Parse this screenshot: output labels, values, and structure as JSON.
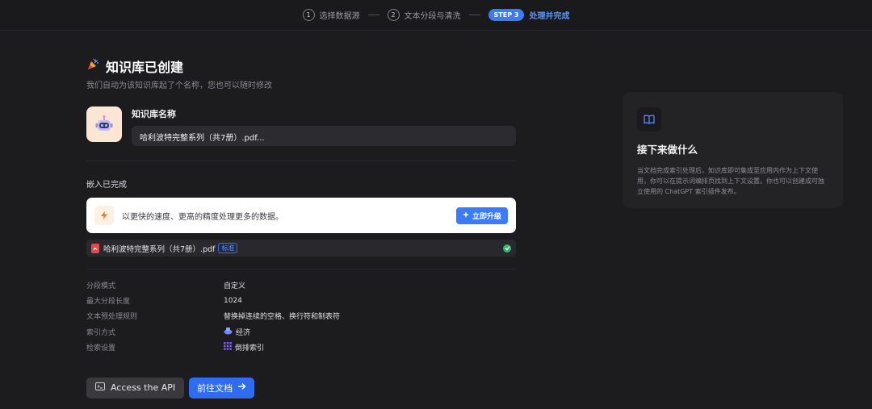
{
  "stepper": {
    "step1": {
      "num": "1",
      "label": "选择数据源"
    },
    "step2": {
      "num": "2",
      "label": "文本分段与清洗"
    },
    "step3": {
      "pill": "STEP 3",
      "label": "处理并完成"
    }
  },
  "header": {
    "icon": "party-popper-icon",
    "title": "知识库已创建",
    "subtitle": "我们自动为该知识库起了个名称，您也可以随时修改"
  },
  "kb": {
    "avatar_icon": "robot-avatar-icon",
    "name_label": "知识库名称",
    "name_value": "哈利波特完整系列（共7册）.pdf..."
  },
  "embedding": {
    "status_label": "嵌入已完成",
    "upgrade_text": "以更快的速度、更高的精度处理更多的数据。",
    "upgrade_button": "立即升级",
    "file_name": "哈利波特完整系列（共7册）.pdf",
    "file_badge": "标准"
  },
  "settings": [
    {
      "key": "分段模式",
      "value": "自定义",
      "icon": ""
    },
    {
      "key": "最大分段长度",
      "value": "1024",
      "icon": ""
    },
    {
      "key": "文本预处理规则",
      "value": "替换掉连续的空格、换行符和制表符",
      "icon": ""
    },
    {
      "key": "索引方式",
      "value": "经济",
      "icon": "economy-icon"
    },
    {
      "key": "检索设置",
      "value": "倒排索引",
      "icon": "inverted-index-icon"
    }
  ],
  "actions": {
    "api_button": "Access the API",
    "docs_button": "前往文档"
  },
  "side": {
    "icon": "book-icon",
    "title": "接下来做什么",
    "description": "当文档完成索引处理后，知识库即可集成至应用内作为上下文使用，你可以在提示词编排页找到上下文设置。你也可以创建成可独立使用的 ChatGPT 索引插件发布。"
  },
  "colors": {
    "accent": "#3d7bf5",
    "background": "#1c1c1e",
    "success": "#2fb96a",
    "pdf": "#e5484d"
  }
}
